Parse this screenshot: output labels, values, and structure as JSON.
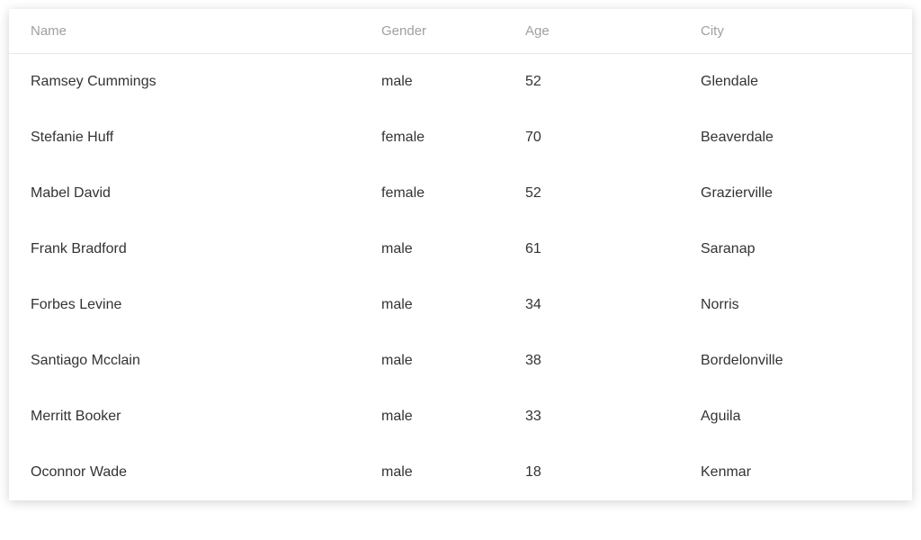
{
  "table": {
    "columns": [
      {
        "key": "name",
        "label": "Name"
      },
      {
        "key": "gender",
        "label": "Gender"
      },
      {
        "key": "age",
        "label": "Age"
      },
      {
        "key": "city",
        "label": "City"
      }
    ],
    "rows": [
      {
        "name": "Ramsey Cummings",
        "gender": "male",
        "age": "52",
        "city": "Glendale"
      },
      {
        "name": "Stefanie Huff",
        "gender": "female",
        "age": "70",
        "city": "Beaverdale"
      },
      {
        "name": "Mabel David",
        "gender": "female",
        "age": "52",
        "city": "Grazierville"
      },
      {
        "name": "Frank Bradford",
        "gender": "male",
        "age": "61",
        "city": "Saranap"
      },
      {
        "name": "Forbes Levine",
        "gender": "male",
        "age": "34",
        "city": "Norris"
      },
      {
        "name": "Santiago Mcclain",
        "gender": "male",
        "age": "38",
        "city": "Bordelonville"
      },
      {
        "name": "Merritt Booker",
        "gender": "male",
        "age": "33",
        "city": "Aguila"
      },
      {
        "name": "Oconnor Wade",
        "gender": "male",
        "age": "18",
        "city": "Kenmar"
      }
    ]
  }
}
